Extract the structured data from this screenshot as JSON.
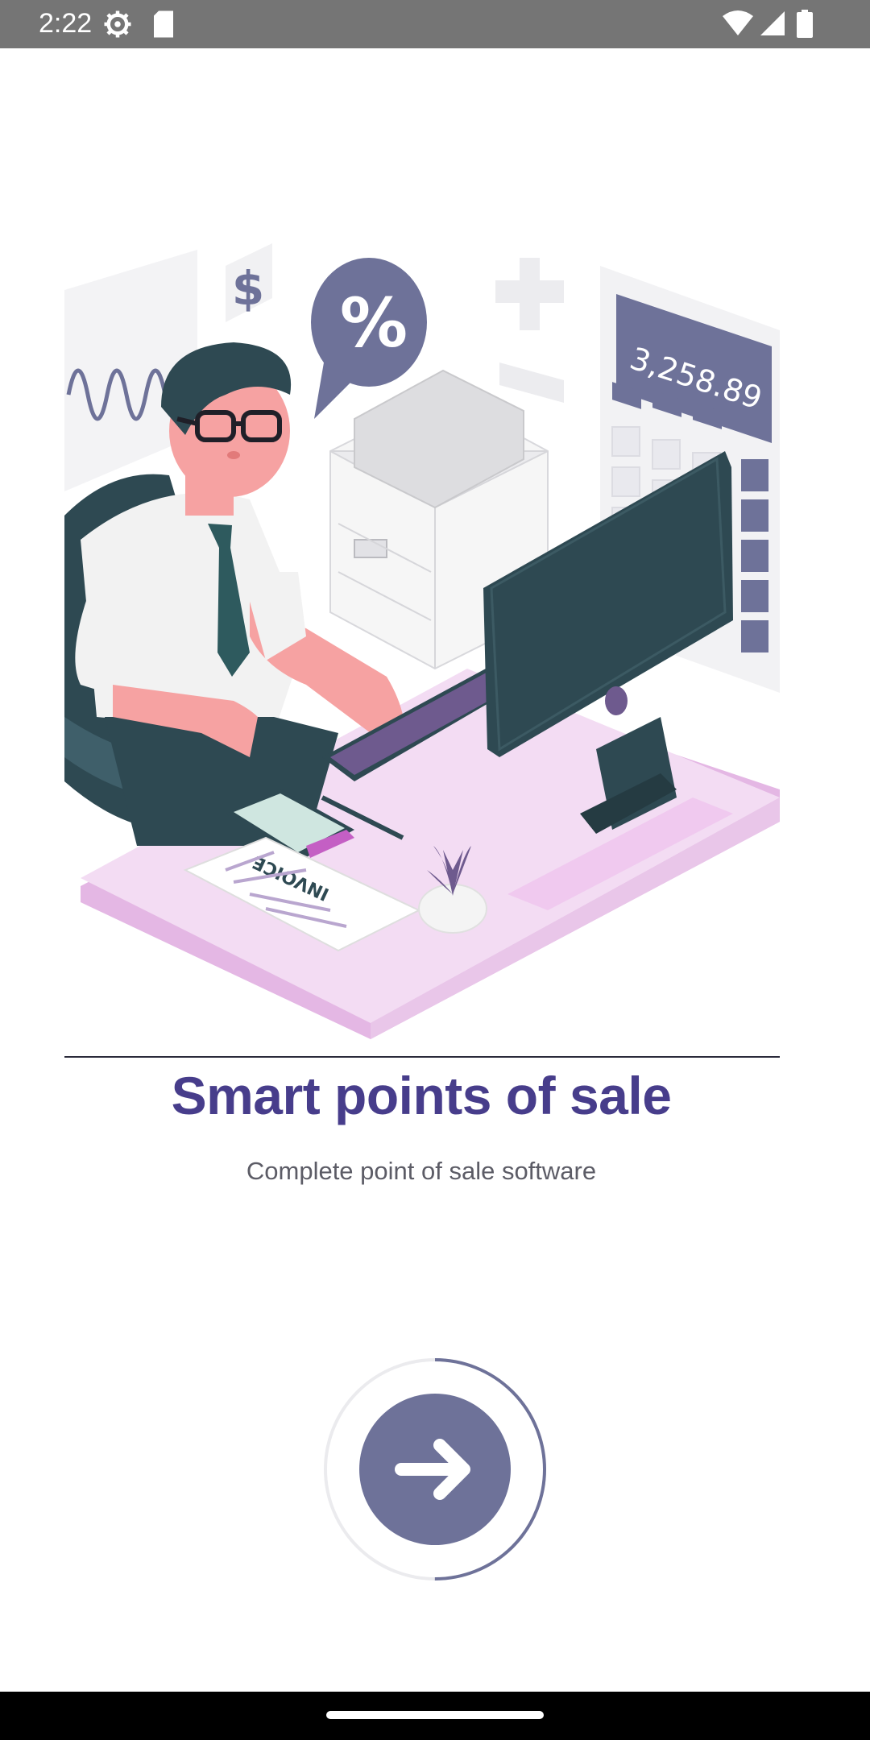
{
  "status_bar": {
    "time": "2:22",
    "icons": [
      "settings-gear-icon",
      "sd-card-icon",
      "wifi-icon",
      "signal-icon",
      "battery-icon"
    ]
  },
  "illustration": {
    "calculator_display": "3,258.89",
    "invoice_label": "INVOICE",
    "percent_symbol": "%",
    "dollar_symbol": "$"
  },
  "onboarding": {
    "title": "Smart points of sale",
    "subtitle": "Complete point of sale software",
    "progress": 0.5
  },
  "colors": {
    "accent": "#473d8b",
    "button": "#6e7299",
    "status_bar": "#757575",
    "desk": "#f3dcf3"
  }
}
